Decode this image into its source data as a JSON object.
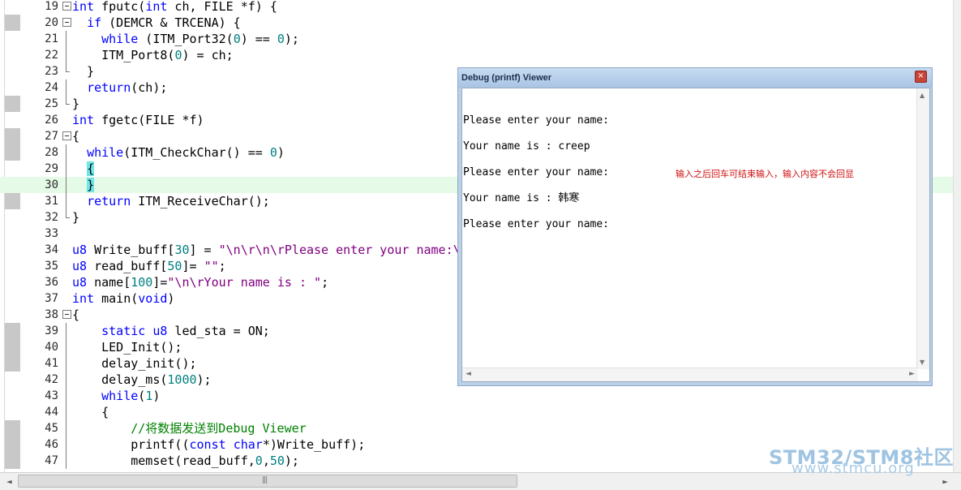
{
  "code_lines": [
    {
      "ln": "19",
      "html": "<span class=\"k\">int</span> fputc(<span class=\"k\">int</span> ch, FILE *f) {"
    },
    {
      "ln": "20",
      "html": "  <span class=\"k\">if</span> (DEMCR &amp; TRCENA) {"
    },
    {
      "ln": "21",
      "html": "    <span class=\"k\">while</span> (ITM_Port32(<span class=\"n\">0</span>) == <span class=\"n\">0</span>);"
    },
    {
      "ln": "22",
      "html": "    ITM_Port8(<span class=\"n\">0</span>) = ch;"
    },
    {
      "ln": "23",
      "html": "  }"
    },
    {
      "ln": "24",
      "html": "  <span class=\"k\">return</span>(ch);"
    },
    {
      "ln": "25",
      "html": "}"
    },
    {
      "ln": "26",
      "html": "<span class=\"k\">int</span> fgetc(FILE *f)"
    },
    {
      "ln": "27",
      "html": "{"
    },
    {
      "ln": "28",
      "html": "  <span class=\"k\">while</span>(ITM_CheckChar() == <span class=\"n\">0</span>)"
    },
    {
      "ln": "29",
      "html": "  <span class=\"brace-hl\">{</span>"
    },
    {
      "ln": "30",
      "html": "  <span class=\"brace-hl\">}</span>"
    },
    {
      "ln": "31",
      "html": "  <span class=\"k\">return</span> ITM_ReceiveChar();"
    },
    {
      "ln": "32",
      "html": "}"
    },
    {
      "ln": "33",
      "html": ""
    },
    {
      "ln": "34",
      "html": "<span class=\"k\">u8</span> Write_buff[<span class=\"n\">30</span>] = <span class=\"s\">\"\\n\\r\\n\\rPlease enter your name:\\</span>"
    },
    {
      "ln": "35",
      "html": "<span class=\"k\">u8</span> read_buff[<span class=\"n\">50</span>]= <span class=\"s\">\"\"</span>;"
    },
    {
      "ln": "36",
      "html": "<span class=\"k\">u8</span> name[<span class=\"n\">100</span>]=<span class=\"s\">\"\\n\\rYour name is : \"</span>;"
    },
    {
      "ln": "37",
      "html": "<span class=\"k\">int</span> main(<span class=\"k\">void</span>)"
    },
    {
      "ln": "38",
      "html": "{"
    },
    {
      "ln": "39",
      "html": "    <span class=\"k\">static</span> <span class=\"k\">u8</span> led_sta = ON;"
    },
    {
      "ln": "40",
      "html": "    LED_Init();"
    },
    {
      "ln": "41",
      "html": "    delay_init();"
    },
    {
      "ln": "42",
      "html": "    delay_ms(<span class=\"n\">1000</span>);"
    },
    {
      "ln": "43",
      "html": "    <span class=\"k\">while</span>(<span class=\"n\">1</span>)"
    },
    {
      "ln": "44",
      "html": "    {"
    },
    {
      "ln": "45",
      "html": "        <span class=\"c\">//将数据发送到Debug Viewer</span>"
    },
    {
      "ln": "46",
      "html": "        printf((<span class=\"k\">const</span> <span class=\"k\">char</span>*)Write_buff);"
    },
    {
      "ln": "47",
      "html": "        memset(read_buff,<span class=\"n\">0</span>,<span class=\"n\">50</span>);"
    }
  ],
  "debug_window": {
    "title": "Debug (printf) Viewer",
    "close_glyph": "×",
    "output_lines": [
      "Please enter your name:",
      "Your name is : creep",
      "Please enter your name:",
      "Your name is : 韩寒",
      "Please enter your name:"
    ]
  },
  "annotation": "输入之后回车可结束输入，输入内容不会回显",
  "watermark": {
    "brand": "STM32/STM8社区",
    "url": "www.stmcu.org"
  },
  "scrollbar": {
    "left_arrow": "◄",
    "right_arrow": "►",
    "grip": "|||"
  },
  "colors": {
    "keyword": "#0000ff",
    "string": "#800080",
    "number": "#008080",
    "comment": "#008000",
    "current_line": "#e6fae8",
    "annotation": "#d01010"
  }
}
